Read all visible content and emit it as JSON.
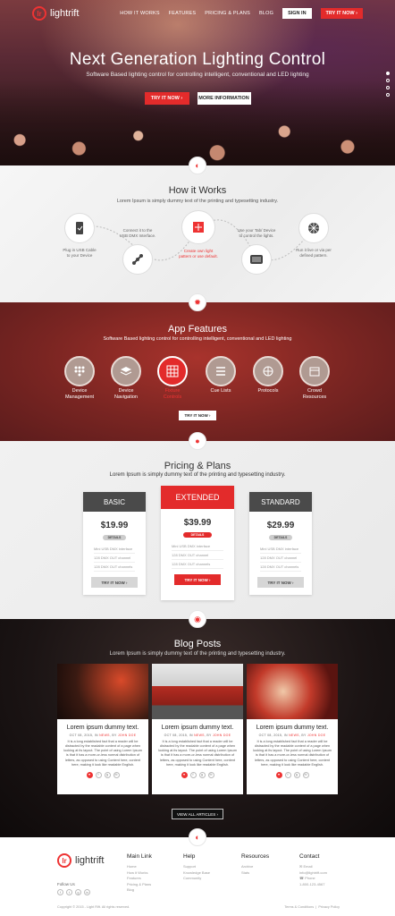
{
  "brand": {
    "mark": "lr",
    "name": "lightrift"
  },
  "nav": {
    "items": [
      "HOW IT WORKS",
      "FEATURES",
      "PRICING & PLANS",
      "BLOG"
    ],
    "sign_in": "SIGN IN",
    "try_it": "TRY IT NOW ›"
  },
  "hero": {
    "title": "Next Generation Lighting Control",
    "subtitle": "Software Based lighting control for controlling intelligent, conventional and LED lighting",
    "btn_try": "TRY IT NOW ›",
    "btn_more": "MORE INFORMATION",
    "slides": 4,
    "active_slide": 1
  },
  "how": {
    "title": "How it Works",
    "subtitle": "Lorem Ipsum is simply dummy text of the printing and typesetting industry.",
    "steps": [
      {
        "label": "Plug in USB Cable\nto your Device",
        "icon": "usb-device-icon"
      },
      {
        "label": "Connect it to the\nUSB DMX Interface.",
        "icon": "usb-dmx-icon"
      },
      {
        "label": "Create own light\npattern or use default.",
        "icon": "light-pattern-icon"
      },
      {
        "label": "Use your Tab/ Device\nto control the lights.",
        "icon": "tablet-icon"
      },
      {
        "label": "Run it live or via per\ndefined pattern.",
        "icon": "network-icon"
      }
    ]
  },
  "features": {
    "title": "App Features",
    "subtitle": "Software Based lighting control for controlling intelligent, conventional and LED lighting",
    "items": [
      "Device\nManagement",
      "Device\nNavigation",
      "Fixture\nControls",
      "Cue Lists",
      "Protocols",
      "Crowd\nResources"
    ],
    "active": 2,
    "btn": "TRY IT NOW ›"
  },
  "pricing": {
    "title": "Pricing & Plans",
    "subtitle": "Lorem Ipsum is simply dummy text of the printing and typesetting industry.",
    "plans": [
      {
        "name": "BASIC",
        "price": "$19.99",
        "details": "DETAILS",
        "features": [
          "Mini USB DMX interface",
          "128 DMX OUT channel",
          "128 DMX OUT channels"
        ],
        "btn": "TRY IT NOW ›"
      },
      {
        "name": "EXTENDED",
        "price": "$39.99",
        "details": "DETAILS",
        "features": [
          "Mini USB DMX interface",
          "128 DMX OUT channel",
          "128 DMX OUT channels"
        ],
        "btn": "TRY IT NOW ›"
      },
      {
        "name": "STANDARD",
        "price": "$29.99",
        "details": "DETAILS",
        "features": [
          "Mini USB DMX interface",
          "128 DMX OUT channel",
          "128 DMX OUT channels"
        ],
        "btn": "TRY IT NOW ›"
      }
    ]
  },
  "blog": {
    "title": "Blog Posts",
    "subtitle": "Lorem Ipsum is simply dummy text of the printing and typesetting industry.",
    "posts": [
      {
        "title": "Lorem ipsum dummy text.",
        "date": "OCT 08, 2015, IN",
        "cat": "NEWS",
        "by": ", BY",
        "author": "JOHN DOE",
        "excerpt": "It is a long established fact that a reader will be distracted by the readable content of a page when looking at its layout. The point of using Lorem Ipsum is that it has a more-or-less normal distribution of letters, as opposed to using Content here, content here, making it look like readable English."
      },
      {
        "title": "Lorem ipsum dummy text.",
        "date": "OCT 08, 2015, IN",
        "cat": "NEWS",
        "by": ", BY",
        "author": "JOHN DOE",
        "excerpt": "It is a long established fact that a reader will be distracted by the readable content of a page when looking at its layout. The point of using Lorem Ipsum is that it has a more-or-less normal distribution of letters, as opposed to using Content here, content here, making it look like readable English."
      },
      {
        "title": "Lorem ipsum dummy text.",
        "date": "OCT 08, 2015, IN",
        "cat": "NEWS",
        "by": ", BY",
        "author": "JOHN DOE",
        "excerpt": "It is a long established fact that a reader will be distracted by the readable content of a page when looking at its layout. The point of using Lorem Ipsum is that it has a more-or-less normal distribution of letters, as opposed to using Content here, content here, making it look like readable English."
      }
    ],
    "view_all": "VIEW ALL ARTICLES ›"
  },
  "footer": {
    "follow": "Follow Us",
    "cols": [
      {
        "title": "Main Link",
        "links": [
          "Home",
          "How it Works",
          "Features",
          "Pricing & Plans",
          "Blog"
        ]
      },
      {
        "title": "Help",
        "links": [
          "Support",
          "Knowledge Base",
          "Community"
        ]
      },
      {
        "title": "Resources",
        "links": [
          "Archive",
          "Stats"
        ]
      },
      {
        "title": "Contact",
        "links": [
          "Email",
          "info@lightrift.com",
          "Phone",
          "1-800-123-4567"
        ]
      }
    ],
    "copyright": "Copyright © 2015 - Light Rift. All rights reserved.",
    "terms": "Terms & Conditions",
    "privacy": "Privacy Policy"
  },
  "colors": {
    "accent": "#e32b2b",
    "dark": "#4a4a4a"
  }
}
